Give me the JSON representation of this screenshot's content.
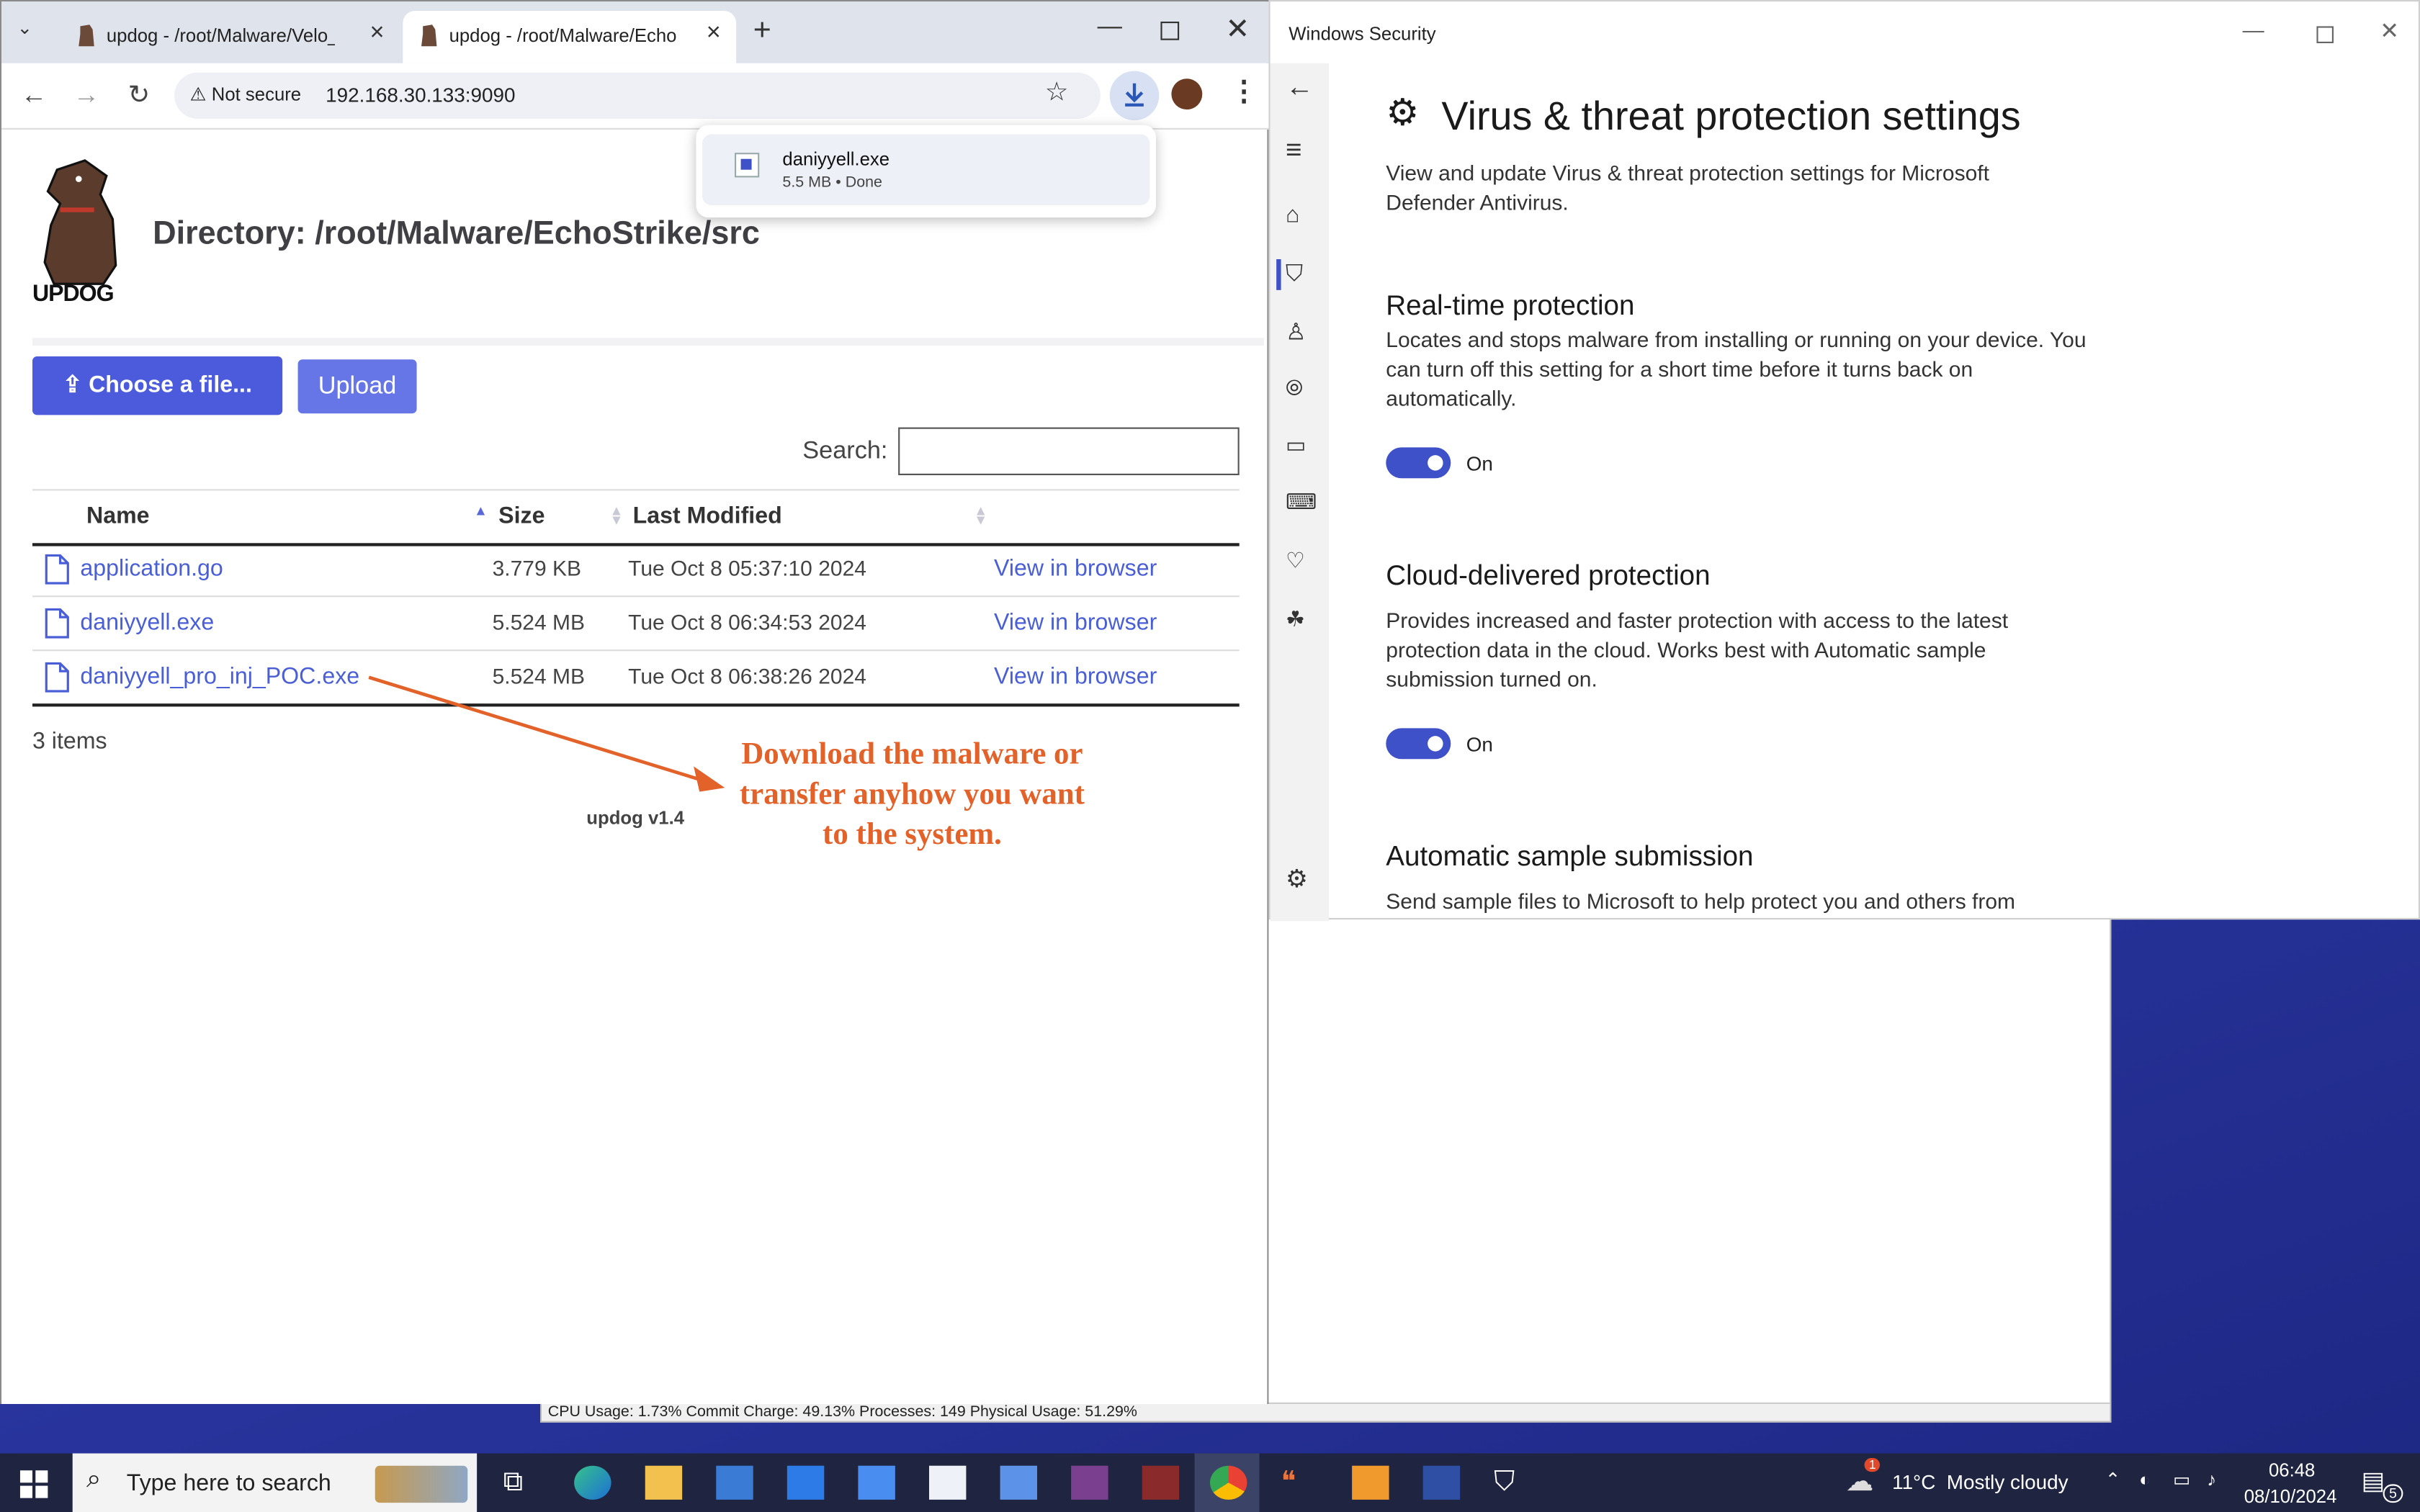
{
  "browser": {
    "tabs": [
      {
        "title": "updog - /root/Malware/Velo_DFIR"
      },
      {
        "title": "updog - /root/Malware/EchoStrike/src"
      }
    ],
    "not_secure": "Not secure",
    "url": "192.168.30.133:9090"
  },
  "download_popup": {
    "filename": "daniyyell.exe",
    "detail": "5.5 MB • Done"
  },
  "page": {
    "logo_text": "UPDOG",
    "title": "Directory: /root/Malware/EchoStrike/src",
    "choose_label": "Choose a file...",
    "upload_label": "Upload",
    "search_label": "Search:",
    "columns": {
      "name": "Name",
      "size": "Size",
      "modified": "Last Modified"
    },
    "files": [
      {
        "name": "application.go",
        "size": "3.779 KB",
        "modified": "Tue Oct 8 05:37:10 2024",
        "action": "View in browser"
      },
      {
        "name": "daniyyell.exe",
        "size": "5.524 MB",
        "modified": "Tue Oct 8 06:34:53 2024",
        "action": "View in browser"
      },
      {
        "name": "daniyyell_pro_inj_POC.exe",
        "size": "5.524 MB",
        "modified": "Tue Oct 8 06:38:26 2024",
        "action": "View in browser"
      }
    ],
    "count": "3 items",
    "version": "updog v1.4",
    "annotation_lines": [
      "Download the malware or",
      "transfer anyhow you want",
      "to the system."
    ],
    "annotation_color": "#e2622a"
  },
  "background_window": {
    "status": "CPU Usage: 1.73%    Commit Charge: 49.13%  Processes: 149  Physical Usage: 51.29%"
  },
  "windows_security": {
    "window_title": "Windows Security",
    "heading": "Virus & threat protection settings",
    "intro": "View and update Virus & threat protection settings for Microsoft Defender Antivirus.",
    "sections": [
      {
        "title": "Real-time protection",
        "text": "Locates and stops malware from installing or running on your device. You can turn off this setting for a short time before it turns back on automatically.",
        "state": "On"
      },
      {
        "title": "Cloud-delivered protection",
        "text": "Provides increased and faster protection with access to the latest protection data in the cloud. Works best with Automatic sample submission turned on.",
        "state": "On"
      },
      {
        "title": "Automatic sample submission",
        "text": "Send sample files to Microsoft to help protect you and others from"
      }
    ],
    "accent": "#3f51c9"
  },
  "taskbar": {
    "search_placeholder": "Type here to search",
    "weather": "11°C  Mostly cloudy",
    "weather_badge": "1",
    "time": "06:48",
    "date": "08/10/2024",
    "notification_count": "5",
    "icons": [
      "task-view-icon",
      "edge-icon",
      "file-explorer-icon",
      "store-icon",
      "mail-icon",
      "todo-icon",
      "notepad-icon",
      "search-app-icon",
      "affinity-icon",
      "binary-tool-icon",
      "chrome-icon",
      "quote-app-icon",
      "sublime-icon",
      "powershell-icon",
      "windows-security-icon"
    ]
  }
}
